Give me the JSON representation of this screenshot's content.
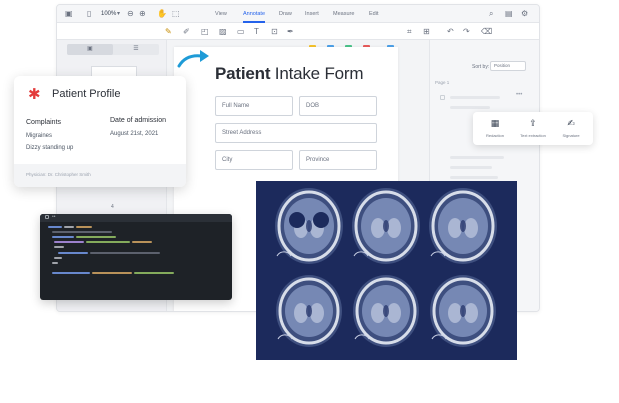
{
  "toolbar": {
    "zoom": "100%",
    "tabs": [
      "View",
      "Annotate",
      "Draw",
      "Insert",
      "Measure",
      "Edit"
    ],
    "active_tab": "Annotate"
  },
  "left_panel": {
    "page_number": "4"
  },
  "form": {
    "title_bold": "Patient",
    "title_rest": " Intake Form",
    "fields": {
      "full_name": "Full Name",
      "dob": "DOB",
      "street": "Street Address",
      "city": "City",
      "province": "Province"
    }
  },
  "right_panel": {
    "sort_label": "Sort by:",
    "sort_value": "Position",
    "page_label": "Page 1"
  },
  "profile": {
    "title": "Patient Profile",
    "complaints_label": "Complaints",
    "complaints": [
      "Migraines",
      "Dizzy standing up"
    ],
    "admission_label": "Date of admission",
    "admission_date": "August 21st, 2021",
    "physician": "Physician: Dr. Christopher Smith"
  },
  "tools": [
    {
      "label": "Redaction",
      "icon": "redaction-icon"
    },
    {
      "label": "Text extraction",
      "icon": "text-extraction-icon"
    },
    {
      "label": "Signature",
      "icon": "signature-icon"
    }
  ],
  "colors": {
    "accent": "#2563eb",
    "arrow": "#1e9bd7",
    "asterisk": "#e33b3b",
    "mri_background": "#1c2a5c"
  }
}
